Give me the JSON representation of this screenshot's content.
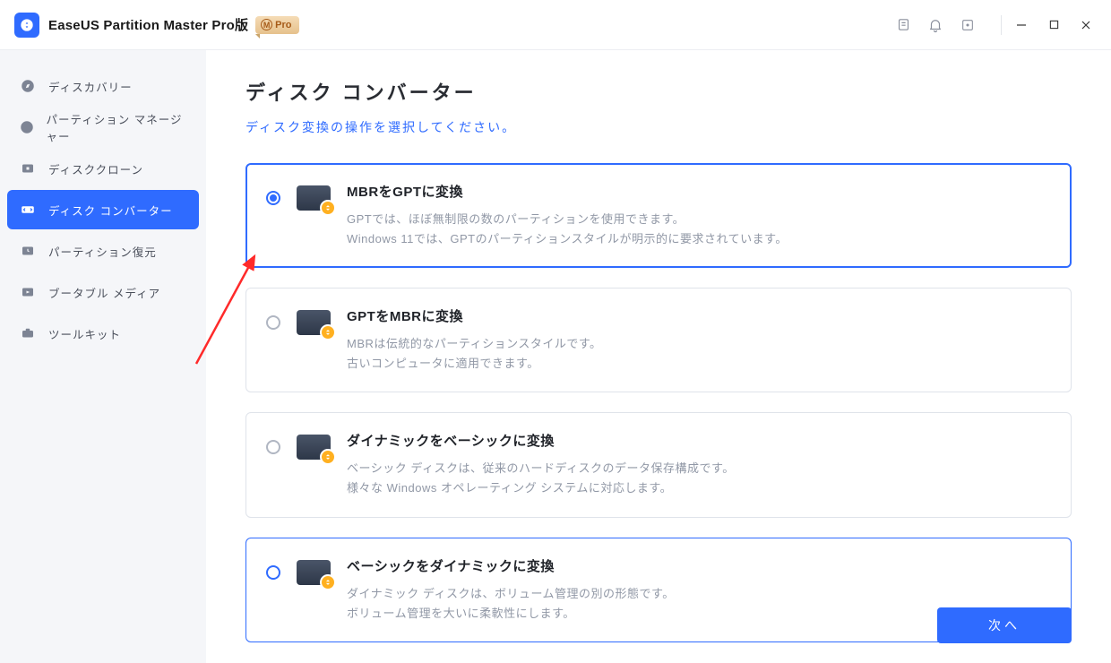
{
  "app": {
    "title": "EaseUS Partition Master Pro版",
    "pro_badge_letter": "M",
    "pro_badge_text": "Pro"
  },
  "sidebar": {
    "items": [
      {
        "icon": "compass-icon",
        "label": "ディスカバリー"
      },
      {
        "icon": "pie-icon",
        "label": "パーティション マネージャー"
      },
      {
        "icon": "clone-icon",
        "label": "ディスククローン"
      },
      {
        "icon": "convert-icon",
        "label": "ディスク コンバーター"
      },
      {
        "icon": "recover-icon",
        "label": "パーティション復元"
      },
      {
        "icon": "media-icon",
        "label": "ブータブル メディア"
      },
      {
        "icon": "toolkit-icon",
        "label": "ツールキット"
      }
    ],
    "active_index": 3
  },
  "main": {
    "title": "ディスク コンバーター",
    "subtitle": "ディスク変換の操作を選択してください。",
    "options": [
      {
        "title": "MBRをGPTに変換",
        "desc": "GPTでは、ほぼ無制限の数のパーティションを使用できます。\nWindows 11では、GPTのパーティションスタイルが明示的に要求されています。",
        "state": "selected"
      },
      {
        "title": "GPTをMBRに変換",
        "desc": "MBRは伝統的なパーティションスタイルです。\n古いコンピュータに適用できます。",
        "state": "normal"
      },
      {
        "title": "ダイナミックをベーシックに変換",
        "desc": "ベーシック ディスクは、従来のハードディスクのデータ保存構成です。\n様々な Windows オペレーティング システムに対応します。",
        "state": "normal"
      },
      {
        "title": "ベーシックをダイナミックに変換",
        "desc": "ダイナミック ディスクは、ボリューム管理の別の形態です。\nボリューム管理を大いに柔軟性にします。",
        "state": "hover"
      }
    ],
    "next_button": "次へ"
  }
}
